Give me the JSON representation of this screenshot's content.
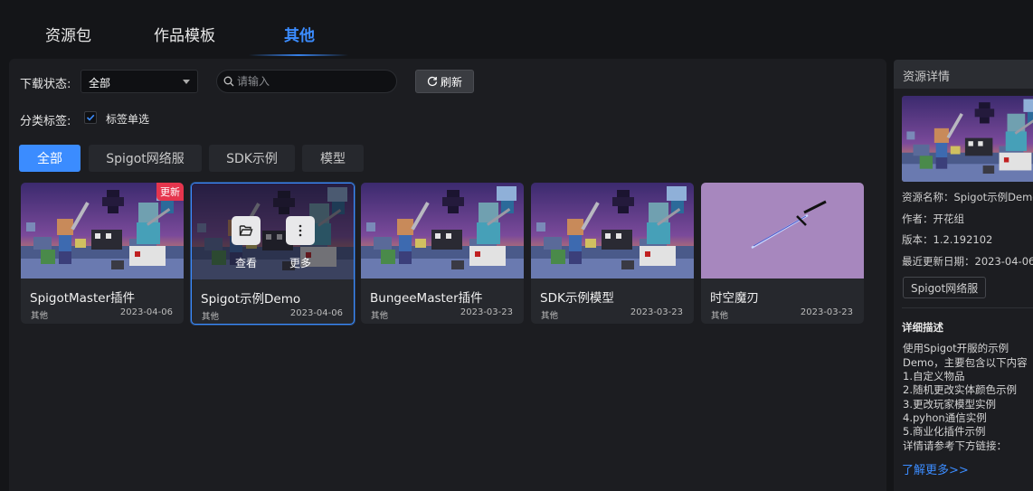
{
  "tabs": [
    {
      "label": "资源包"
    },
    {
      "label": "作品模板"
    },
    {
      "label": "其他"
    }
  ],
  "filters": {
    "download_status_label": "下载状态:",
    "download_status_value": "全部",
    "search_placeholder": "请输入",
    "refresh_label": "刷新",
    "category_label": "分类标签:",
    "single_select_label": "标签单选",
    "single_select_checked": true
  },
  "chips": [
    {
      "label": "全部",
      "active": true
    },
    {
      "label": "Spigot网络服",
      "active": false
    },
    {
      "label": "SDK示例",
      "active": false
    },
    {
      "label": "模型",
      "active": false
    }
  ],
  "cards": [
    {
      "title": "SpigotMaster插件",
      "category": "其他",
      "date": "2023-04-06",
      "badge": "更新"
    },
    {
      "title": "Spigot示例Demo",
      "category": "其他",
      "date": "2023-04-06",
      "view_label": "查看",
      "more_label": "更多"
    },
    {
      "title": "BungeeMaster插件",
      "category": "其他",
      "date": "2023-03-23"
    },
    {
      "title": "SDK示例模型",
      "category": "其他",
      "date": "2023-03-23"
    },
    {
      "title": "时空魔刃",
      "category": "其他",
      "date": "2023-03-23"
    }
  ],
  "detail": {
    "header": "资源详情",
    "name": "资源名称：Spigot示例Demo",
    "author": "作者：开花组",
    "version": "版本：1.2.192102",
    "updated": "最近更新日期：2023-04-06",
    "tag": "Spigot网络服",
    "desc_title": "详细描述",
    "desc_lines": [
      "使用Spigot开服的示例",
      "Demo，主要包含以下内容",
      "1.自定义物品",
      "2.随机更改实体颜色示例",
      "3.更改玩家模型实例",
      "4.pyhon通信实例",
      "5.商业化插件示例",
      "详情请参考下方链接："
    ],
    "more_link": "了解更多>>"
  },
  "colors": {
    "accent": "#3b8cff",
    "badge": "#e5354d",
    "panel": "#1c1d21",
    "background": "#141518",
    "sword_card_bg": "#a787be"
  },
  "icons": [
    "search-icon",
    "refresh-icon",
    "check-icon",
    "folder-open-icon",
    "more-vertical-icon"
  ]
}
